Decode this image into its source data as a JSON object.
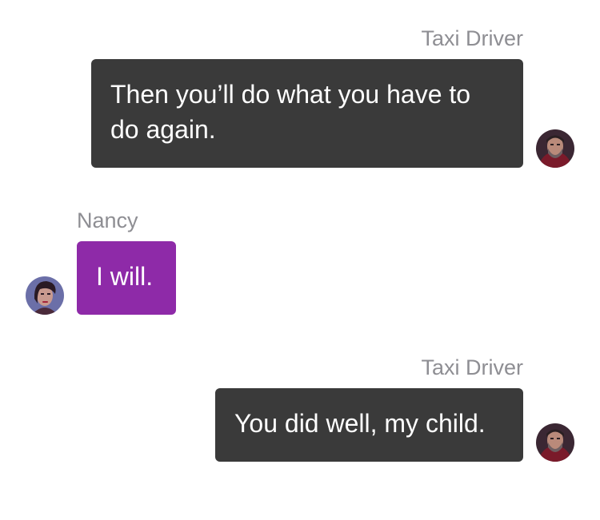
{
  "messages": [
    {
      "sender": "Taxi Driver",
      "text": "Then you’ll do what you have to do again.",
      "side": "right",
      "avatar": "taxi-driver-avatar"
    },
    {
      "sender": "Nancy",
      "text": "I will.",
      "side": "left",
      "avatar": "nancy-avatar"
    },
    {
      "sender": "Taxi Driver",
      "text": "You did well, my child.",
      "side": "right",
      "avatar": "taxi-driver-avatar"
    }
  ],
  "colors": {
    "outgoing_bubble": "#3a3a3a",
    "incoming_bubble": "#8e2aa8",
    "sender_label": "#8e8e93",
    "background": "#ffffff"
  }
}
